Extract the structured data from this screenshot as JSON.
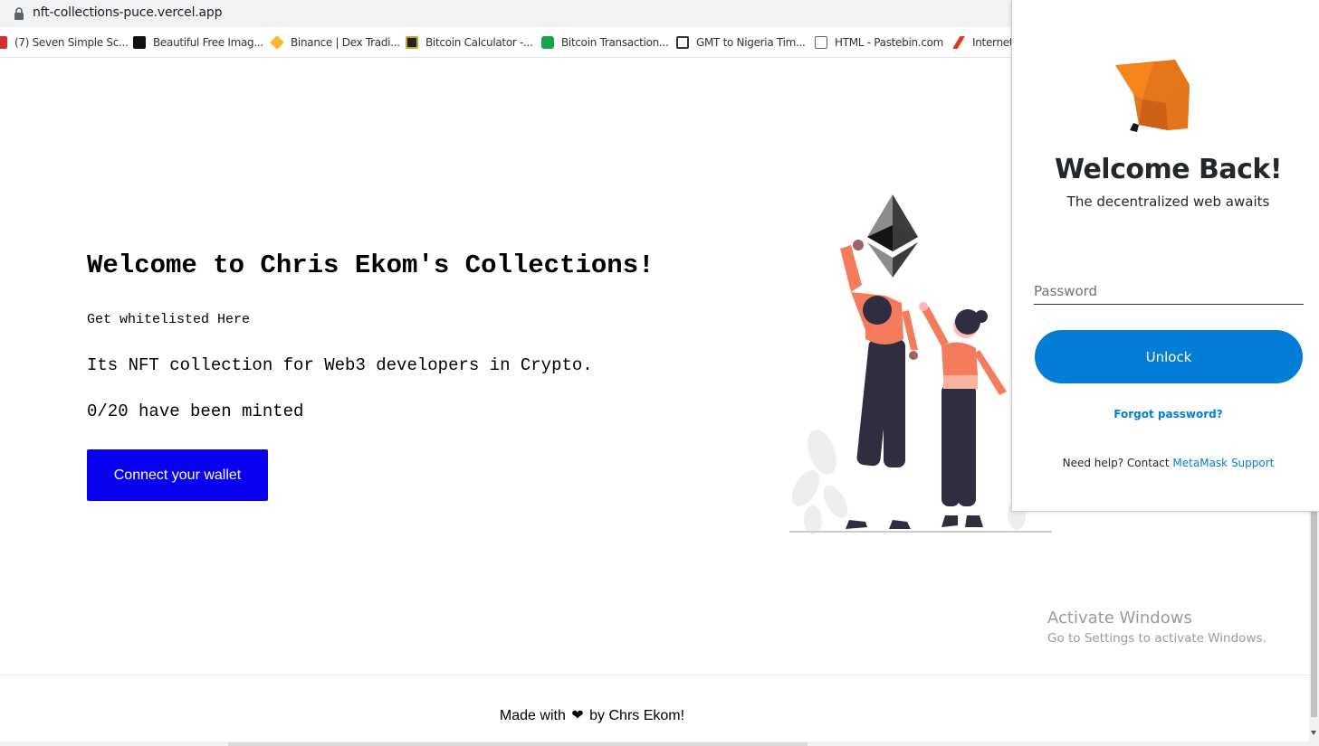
{
  "browser": {
    "url": "nft-collections-puce.vercel.app",
    "bookmarks": [
      {
        "label": "(7) Seven Simple Sc...",
        "icon": "youtube-icon",
        "color": "#d32f2f"
      },
      {
        "label": "Beautiful Free Imag...",
        "icon": "unsplash-icon",
        "color": "#111111"
      },
      {
        "label": "Binance | Dex Tradi...",
        "icon": "binance-icon",
        "color": "#f3ba2f"
      },
      {
        "label": "Bitcoin Calculator -...",
        "icon": "calculator-icon",
        "color": "#222222"
      },
      {
        "label": "Bitcoin Transaction...",
        "icon": "transaction-icon",
        "color": "#16a34a"
      },
      {
        "label": "GMT to Nigeria Tim...",
        "icon": "timezone-icon",
        "color": "#333333"
      },
      {
        "label": "HTML - Pastebin.com",
        "icon": "pastebin-icon",
        "color": "#666666"
      },
      {
        "label": "Internet",
        "icon": "internet-icon",
        "color": "#e03a1e"
      }
    ]
  },
  "main": {
    "headline": "Welcome to Chris Ekom's Collections!",
    "subtitle": "Get whitelisted Here",
    "description": "Its NFT collection for Web3 developers in Crypto.",
    "minted": "0/20 have been minted",
    "connect_button": "Connect your wallet"
  },
  "footer": {
    "prefix": "Made with",
    "heart": "❤",
    "suffix": "by Chrs Ekom!"
  },
  "windows_watermark": {
    "title": "Activate Windows",
    "subtitle": "Go to Settings to activate Windows."
  },
  "metamask": {
    "title": "Welcome Back!",
    "subtitle": "The decentralized web awaits",
    "password_placeholder": "Password",
    "unlock_button": "Unlock",
    "forgot_link": "Forgot password?",
    "help_prefix": "Need help? Contact",
    "help_link": "MetaMask Support",
    "accent": "#037dd6"
  },
  "colors": {
    "connect_button": "#0a00f0",
    "illustration_accent": "#f47b5b"
  }
}
